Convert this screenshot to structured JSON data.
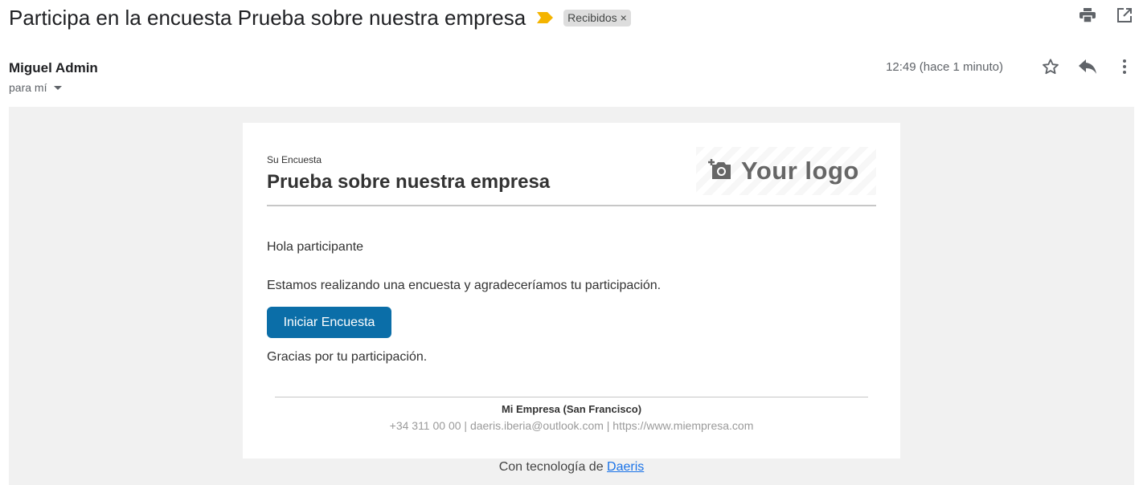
{
  "header": {
    "subject": "Participa en la encuesta Prueba sobre nuestra empresa",
    "label": "Recibidos",
    "label_remove": "×",
    "importance_color": "#f4b400"
  },
  "message": {
    "sender": "Miguel Admin",
    "to": "para mí",
    "timestamp": "12:49 (hace 1 minuto)"
  },
  "icons": {
    "print": "print-icon",
    "new_window": "open-in-new-icon",
    "star": "star-icon",
    "reply": "reply-icon",
    "more": "more-vert-icon"
  },
  "email": {
    "small_heading": "Su Encuesta",
    "title": "Prueba sobre nuestra empresa",
    "logo_text": "Your logo",
    "greeting": "Hola participante",
    "body": "Estamos realizando una encuesta y agradeceríamos tu participación.",
    "cta_label": "Iniciar Encuesta",
    "thanks": "Gracias por tu participación.",
    "company": "Mi Empresa (San Francisco)",
    "contact": "+34 311 00 00 | daeris.iberia@outlook.com | https://www.miempresa.com",
    "powered_prefix": "Con tecnología de",
    "powered_link": "Daeris"
  },
  "colors": {
    "cta_bg": "#0b6ea8",
    "link": "#1a73e8",
    "canvas": "#f1f1f1"
  }
}
